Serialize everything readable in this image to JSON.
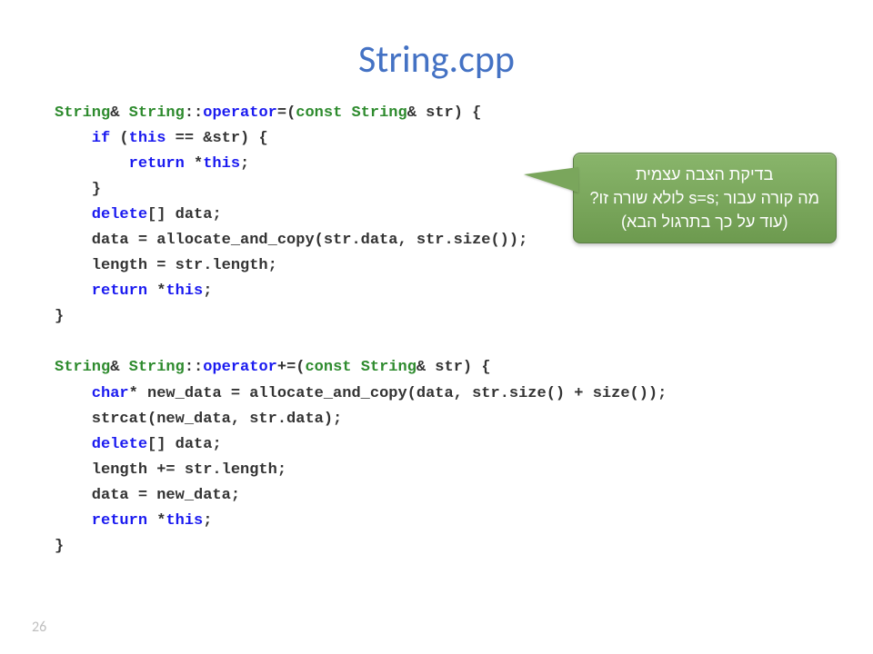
{
  "title": "String.cpp",
  "slide_number": "26",
  "callout": {
    "line1": "בדיקת הצבה עצמית",
    "line2": "מה קורה עבור ;s=s לולא שורה זו?",
    "line3": "(עוד על כך בתרגול הבא)"
  },
  "code": {
    "l1_a": "String",
    "l1_b": "& ",
    "l1_c": "String",
    "l1_d": "::",
    "l1_e": "operator",
    "l1_f": "=(",
    "l1_g": "const String",
    "l1_h": "& str) {",
    "l2_a": "    if",
    "l2_b": " (",
    "l2_c": "this",
    "l2_d": " == &str) {",
    "l3_a": "        return",
    "l3_b": " *",
    "l3_c": "this",
    "l3_d": ";",
    "l4": "    }",
    "l5_a": "    delete",
    "l5_b": "[] data;",
    "l6": "    data = allocate_and_copy(str.data, str.size());",
    "l7": "    length = str.length;",
    "l8_a": "    return",
    "l8_b": " *",
    "l8_c": "this",
    "l8_d": ";",
    "l9": "}",
    "l10": "",
    "l11_a": "String",
    "l11_b": "& ",
    "l11_c": "String",
    "l11_d": "::",
    "l11_e": "operator",
    "l11_f": "+=(",
    "l11_g": "const String",
    "l11_h": "& str) {",
    "l12_a": "    char",
    "l12_b": "* new_data = allocate_and_copy(data, str.size() + size());",
    "l13": "    strcat(new_data, str.data);",
    "l14_a": "    delete",
    "l14_b": "[] data;",
    "l15": "    length += str.length;",
    "l16": "    data = new_data;",
    "l17_a": "    return",
    "l17_b": " *",
    "l17_c": "this",
    "l17_d": ";",
    "l18": "}"
  }
}
